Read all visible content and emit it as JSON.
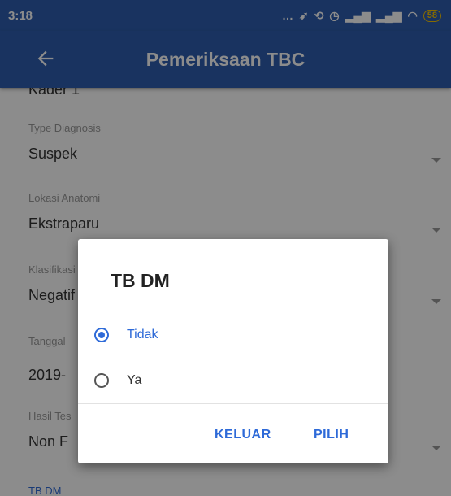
{
  "status_bar": {
    "time": "3:18",
    "battery": "58"
  },
  "app_bar": {
    "title": "Pemeriksaan TBC"
  },
  "form": {
    "top_cut_value": "Kader 1",
    "fields": [
      {
        "label": "Type Diagnosis",
        "value": "Suspek"
      },
      {
        "label": "Lokasi Anatomi",
        "value": "Ekstraparu"
      },
      {
        "label": "Klasifikasi",
        "value": "Negatif"
      },
      {
        "label": "Tanggal",
        "value": "2019-"
      },
      {
        "label": "Hasil Tes",
        "value": "Non F"
      }
    ],
    "bottom_label": "TB DM"
  },
  "dialog": {
    "title": "TB DM",
    "options": [
      {
        "label": "Tidak",
        "selected": true
      },
      {
        "label": "Ya",
        "selected": false
      }
    ],
    "cancel_label": "KELUAR",
    "confirm_label": "PILIH"
  },
  "colors": {
    "primary": "#2e5eaf",
    "accent": "#2e6ad8"
  }
}
